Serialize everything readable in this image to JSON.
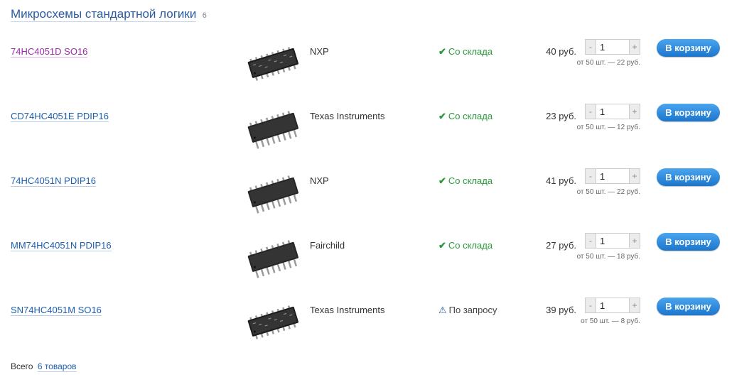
{
  "heading": {
    "title": "Микросхемы стандартной логики",
    "count": "6"
  },
  "products": [
    {
      "name": "74HC4051D SO16",
      "visited": true,
      "package": "SO16",
      "manufacturer": "NXP",
      "stock_status": "Со склада",
      "stock_icon": "checkmark-icon",
      "price": "40 руб.",
      "quantity": "1",
      "bulk_price": "от 50 шт. — 22 руб.",
      "cart_label": "В корзину"
    },
    {
      "name": "CD74HC4051E PDIP16",
      "visited": false,
      "package": "PDIP16",
      "manufacturer": "Texas Instruments",
      "stock_status": "Со склада",
      "stock_icon": "checkmark-icon",
      "price": "23 руб.",
      "quantity": "1",
      "bulk_price": "от 50 шт. — 12 руб.",
      "cart_label": "В корзину"
    },
    {
      "name": "74HC4051N PDIP16",
      "visited": false,
      "package": "PDIP16",
      "manufacturer": "NXP",
      "stock_status": "Со склада",
      "stock_icon": "checkmark-icon",
      "price": "41 руб.",
      "quantity": "1",
      "bulk_price": "от 50 шт. — 22 руб.",
      "cart_label": "В корзину"
    },
    {
      "name": "MM74HC4051N PDIP16",
      "visited": false,
      "package": "PDIP16",
      "manufacturer": "Fairchild",
      "stock_status": "Со склада",
      "stock_icon": "checkmark-icon",
      "price": "27 руб.",
      "quantity": "1",
      "bulk_price": "от 50 шт. — 18 руб.",
      "cart_label": "В корзину"
    },
    {
      "name": "SN74HC4051M SO16",
      "visited": false,
      "package": "SO16",
      "manufacturer": "Texas Instruments",
      "stock_status": "По запросу",
      "stock_icon": "warning-icon",
      "price": "39 руб.",
      "quantity": "1",
      "bulk_price": "от 50 шт. — 8 руб.",
      "cart_label": "В корзину"
    }
  ],
  "qty_controls": {
    "minus": "-",
    "plus": "+"
  },
  "footer": {
    "label": "Всего",
    "link": "6 товаров"
  },
  "colors": {
    "link": "#1d5fb0",
    "visited_link": "#9b2aa6",
    "in_stock": "#2b9a3c",
    "button": "#1c75cc"
  }
}
